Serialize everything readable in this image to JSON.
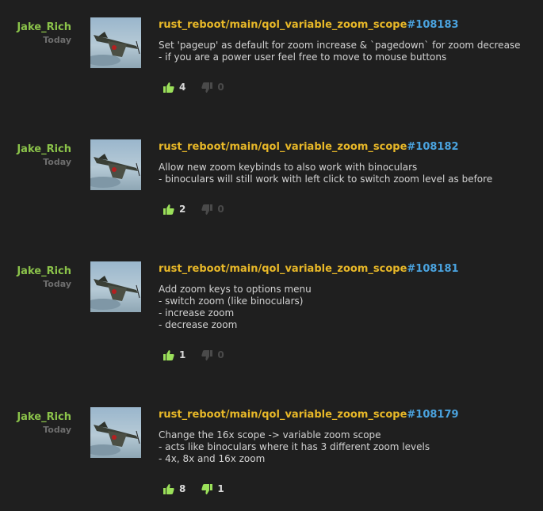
{
  "commits": [
    {
      "author": "Jake_Rich",
      "date": "Today",
      "branch": "rust_reboot/main/qol_variable_zoom_scope",
      "changeset": "#108183",
      "message": [
        "Set 'pageup' as default for zoom increase & `pagedown` for zoom decrease",
        "- if you are a power user feel free to move to mouse buttons"
      ],
      "likes": "4",
      "dislikes": "0"
    },
    {
      "author": "Jake_Rich",
      "date": "Today",
      "branch": "rust_reboot/main/qol_variable_zoom_scope",
      "changeset": "#108182",
      "message": [
        "Allow new zoom keybinds to also work with binoculars",
        "- binoculars will still work with left click to switch zoom level as before"
      ],
      "likes": "2",
      "dislikes": "0"
    },
    {
      "author": "Jake_Rich",
      "date": "Today",
      "branch": "rust_reboot/main/qol_variable_zoom_scope",
      "changeset": "#108181",
      "message": [
        "Add zoom keys to options menu",
        "- switch zoom (like binoculars)",
        "- increase zoom",
        "- decrease zoom"
      ],
      "likes": "1",
      "dislikes": "0"
    },
    {
      "author": "Jake_Rich",
      "date": "Today",
      "branch": "rust_reboot/main/qol_variable_zoom_scope",
      "changeset": "#108179",
      "message": [
        "Change the 16x scope -> variable zoom scope",
        "- acts like binoculars where it has 3 different zoom levels",
        "- 4x, 8x and 16x zoom"
      ],
      "likes": "8",
      "dislikes": "1"
    }
  ],
  "icons": {
    "avatar": "airplane-avatar",
    "like": "thumbs-up-icon",
    "dislike": "thumbs-down-icon"
  },
  "colors": {
    "background": "#1f1f1f",
    "author": "#8bc34a",
    "branch": "#e8b828",
    "changeset": "#4aa3df",
    "like_icon": "#9be05a",
    "dislike_icon": "#4a4a4a"
  }
}
